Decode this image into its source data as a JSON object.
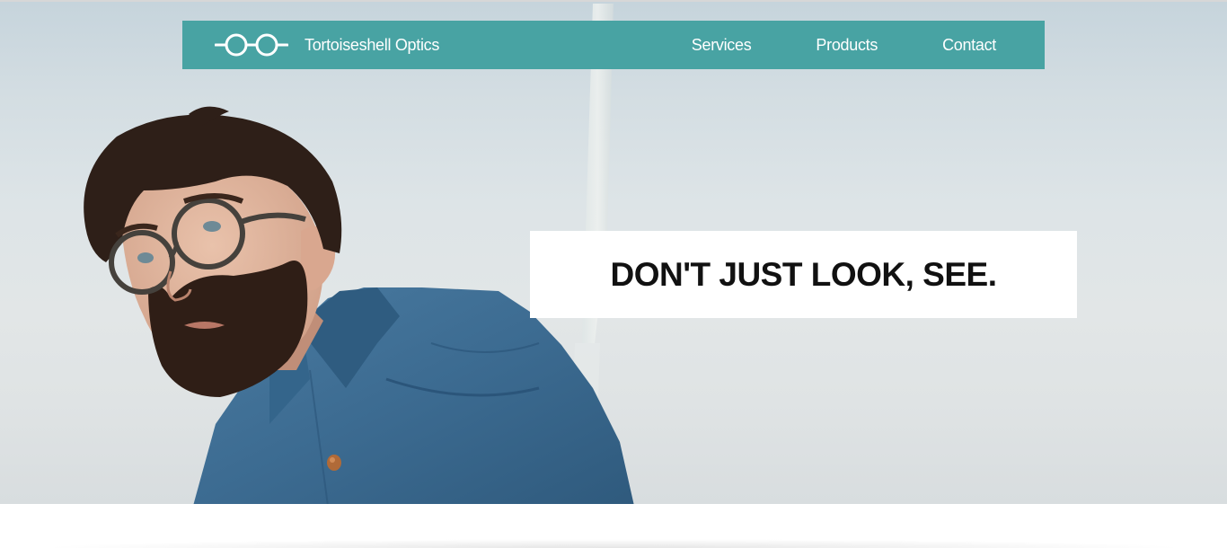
{
  "brand": {
    "name": "Tortoiseshell Optics",
    "logo_icon": "glasses-icon"
  },
  "nav": {
    "items": [
      {
        "label": "Services"
      },
      {
        "label": "Products"
      },
      {
        "label": "Contact"
      }
    ]
  },
  "hero": {
    "tagline": "DON'T JUST LOOK, SEE."
  },
  "colors": {
    "navbar": "#48a3a3",
    "tagline_box": "#ffffff",
    "tagline_text": "#111111",
    "sky": "#dde4e7",
    "shirt": "#3d6d92"
  }
}
